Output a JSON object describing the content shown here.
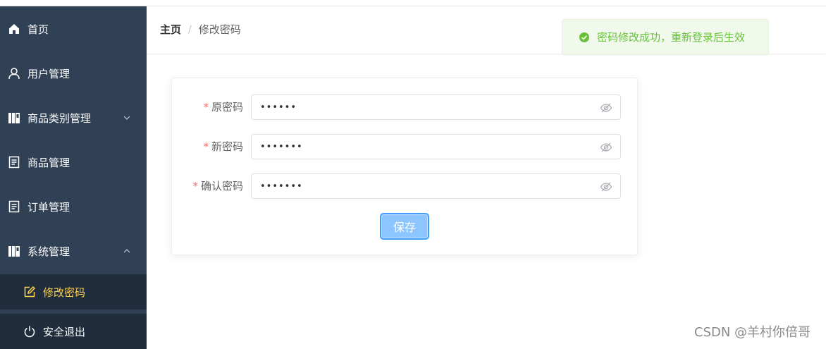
{
  "sidebar": {
    "items": [
      {
        "label": "首页",
        "icon": "home-icon"
      },
      {
        "label": "用户管理",
        "icon": "user-icon"
      },
      {
        "label": "商品类别管理",
        "icon": "category-icon",
        "expanded": false
      },
      {
        "label": "商品管理",
        "icon": "document-icon"
      },
      {
        "label": "订单管理",
        "icon": "document-icon"
      },
      {
        "label": "系统管理",
        "icon": "category-icon",
        "expanded": true
      }
    ],
    "sub_items": [
      {
        "label": "修改密码",
        "icon": "edit-icon",
        "active": true
      },
      {
        "label": "安全退出",
        "icon": "power-icon"
      }
    ]
  },
  "breadcrumb": {
    "home": "主页",
    "separator": "/",
    "current": "修改密码"
  },
  "toast": {
    "message": "密码修改成功，重新登录后生效",
    "type": "success"
  },
  "form": {
    "fields": [
      {
        "label": "原密码",
        "value": "••••••",
        "required": true
      },
      {
        "label": "新密码",
        "value": "•••••••",
        "required": true
      },
      {
        "label": "确认密码",
        "value": "•••••••",
        "required": true
      }
    ],
    "required_mark": "*",
    "save_label": "保存"
  },
  "watermark": "CSDN @羊村你倍哥",
  "colors": {
    "sidebar_bg": "#304156",
    "active_menu": "#ffd04b",
    "primary": "#409eff",
    "success": "#67c23a",
    "danger": "#f56c6c"
  }
}
